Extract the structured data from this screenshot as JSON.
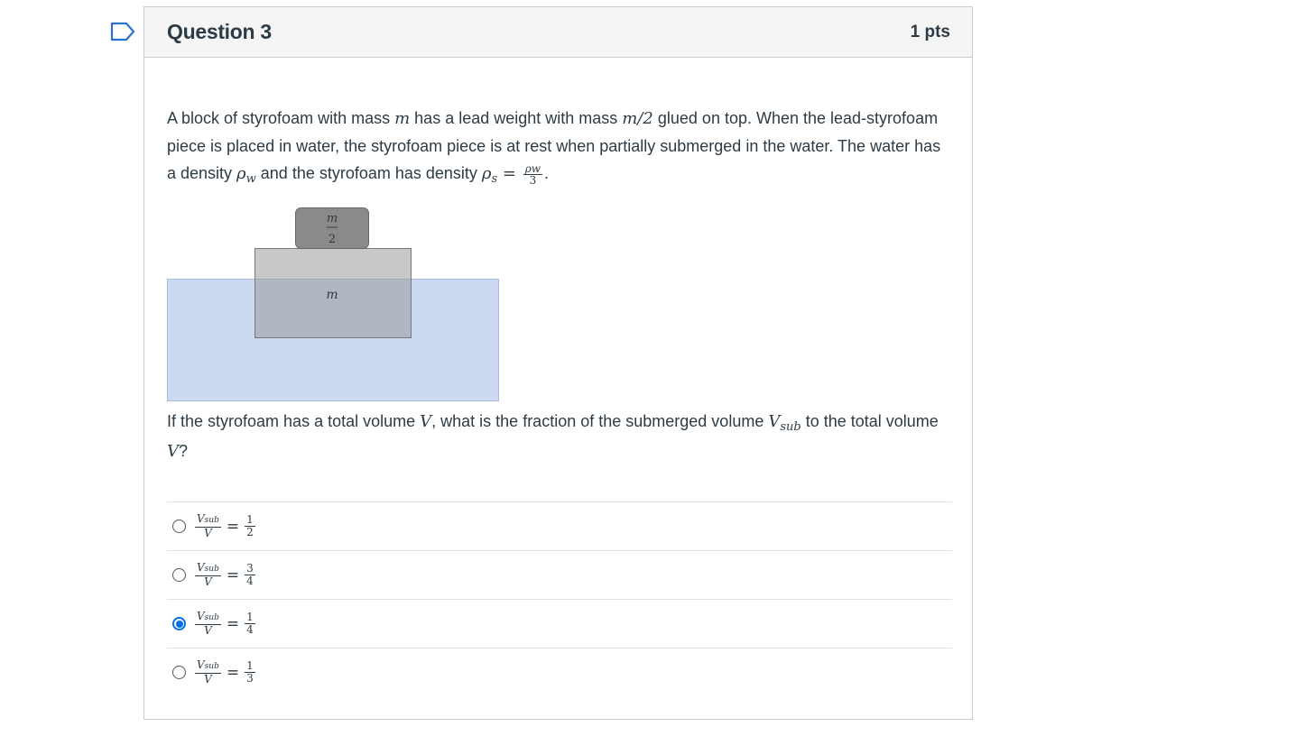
{
  "question": {
    "title": "Question 3",
    "points": "1 pts",
    "text_part1": "A block of styrofoam with mass ",
    "text_part2": " has a lead weight with mass ",
    "text_part3": " glued on top. When the lead-styrofoam piece is placed in water, the styrofoam piece is at rest when partially submerged in the water. The water has a density ",
    "text_part4": " and the styrofoam has density ",
    "math_m": "m",
    "math_m2": "m/2",
    "math_rho": "ρ",
    "math_w": "w",
    "math_s": "s",
    "math_eq": " = ",
    "frac_num": "ρw",
    "frac_den": "3",
    "period": ".",
    "prompt_part1": "If the styrofoam has a total volume ",
    "prompt_V": "V",
    "prompt_part2": ", what is the fraction of the submerged volume ",
    "prompt_Vsub": "V",
    "prompt_sub": "sub",
    "prompt_part3": " to the total volume ",
    "prompt_V2": "V",
    "prompt_end": "?"
  },
  "diagram": {
    "weight_label_num": "m",
    "weight_label_den": "2",
    "block_label": "m",
    "colors": {
      "water": "#ccd9f1",
      "styrofoam": "#c8c8c8",
      "lead": "#8a8a8a"
    }
  },
  "answers": [
    {
      "num": "V",
      "num_sub": "sub",
      "den": "V",
      "eq": "=",
      "rhs_num": "1",
      "rhs_den": "2",
      "selected": false
    },
    {
      "num": "V",
      "num_sub": "sub",
      "den": "V",
      "eq": "=",
      "rhs_num": "3",
      "rhs_den": "4",
      "selected": false
    },
    {
      "num": "V",
      "num_sub": "sub",
      "den": "V",
      "eq": "=",
      "rhs_num": "1",
      "rhs_den": "4",
      "selected": true
    },
    {
      "num": "V",
      "num_sub": "sub",
      "den": "V",
      "eq": "=",
      "rhs_num": "1",
      "rhs_den": "3",
      "selected": false
    }
  ],
  "colors": {
    "accent": "#0770e3",
    "flag": "#2a72d0"
  }
}
